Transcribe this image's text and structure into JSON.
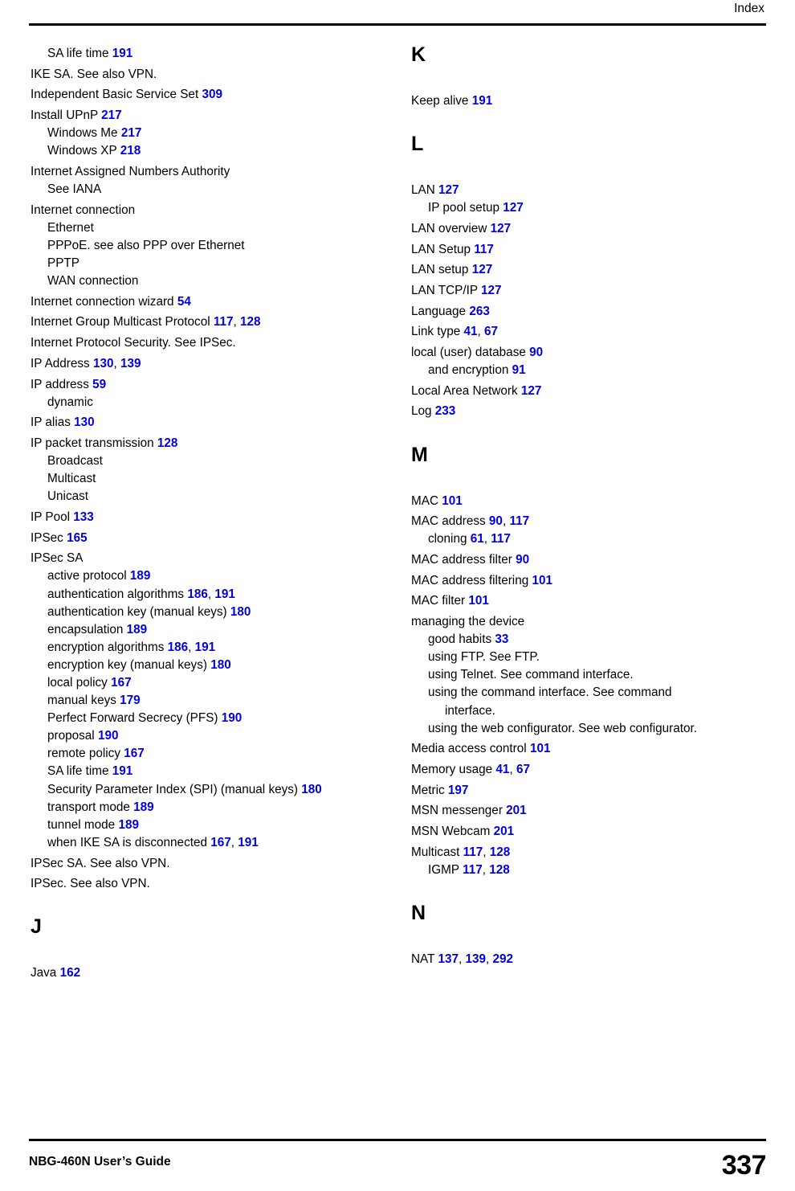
{
  "header": {
    "title": "Index"
  },
  "footer": {
    "guide": "NBG-460N User’s Guide",
    "page_number": "337"
  },
  "colors": {
    "page_ref": "#0000e0",
    "text": "#000000"
  },
  "left_column": {
    "entries": [
      {
        "level": 1,
        "text": "SA life time ",
        "refs": [
          "191"
        ]
      },
      {
        "level": 0,
        "text": "IKE SA. See also VPN.",
        "refs": []
      },
      {
        "level": 0,
        "text": "Independent Basic Service Set ",
        "refs": [
          "309"
        ]
      },
      {
        "level": 0,
        "text": "Install UPnP ",
        "refs": [
          "217"
        ]
      },
      {
        "level": 1,
        "text": "Windows Me ",
        "refs": [
          "217"
        ]
      },
      {
        "level": 1,
        "text": "Windows XP ",
        "refs": [
          "218"
        ]
      },
      {
        "level": 0,
        "text": "Internet Assigned Numbers Authority",
        "refs": []
      },
      {
        "level": 1,
        "text": "See IANA",
        "refs": []
      },
      {
        "level": 0,
        "text": "Internet connection",
        "refs": []
      },
      {
        "level": 1,
        "text": "Ethernet",
        "refs": []
      },
      {
        "level": 1,
        "text": "PPPoE. see also PPP over Ethernet",
        "refs": []
      },
      {
        "level": 1,
        "text": "PPTP",
        "refs": []
      },
      {
        "level": 1,
        "text": "WAN connection",
        "refs": []
      },
      {
        "level": 0,
        "text": "Internet connection wizard ",
        "refs": [
          "54"
        ]
      },
      {
        "level": 0,
        "text": "Internet Group Multicast Protocol ",
        "refs": [
          "117",
          "128"
        ]
      },
      {
        "level": 0,
        "text": "Internet Protocol Security. See IPSec.",
        "refs": []
      },
      {
        "level": 0,
        "text": "IP Address ",
        "refs": [
          "130",
          "139"
        ]
      },
      {
        "level": 0,
        "text": "IP address ",
        "refs": [
          "59"
        ]
      },
      {
        "level": 1,
        "text": "dynamic",
        "refs": []
      },
      {
        "level": 0,
        "text": "IP alias ",
        "refs": [
          "130"
        ]
      },
      {
        "level": 0,
        "text": "IP packet transmission ",
        "refs": [
          "128"
        ]
      },
      {
        "level": 1,
        "text": "Broadcast",
        "refs": []
      },
      {
        "level": 1,
        "text": "Multicast",
        "refs": []
      },
      {
        "level": 1,
        "text": "Unicast",
        "refs": []
      },
      {
        "level": 0,
        "text": "IP Pool ",
        "refs": [
          "133"
        ]
      },
      {
        "level": 0,
        "text": "IPSec ",
        "refs": [
          "165"
        ]
      },
      {
        "level": 0,
        "text": "IPSec SA",
        "refs": []
      },
      {
        "level": 1,
        "text": "active protocol ",
        "refs": [
          "189"
        ]
      },
      {
        "level": 1,
        "text": "authentication algorithms ",
        "refs": [
          "186",
          "191"
        ]
      },
      {
        "level": 1,
        "text": "authentication key (manual keys) ",
        "refs": [
          "180"
        ]
      },
      {
        "level": 1,
        "text": "encapsulation ",
        "refs": [
          "189"
        ]
      },
      {
        "level": 1,
        "text": "encryption algorithms ",
        "refs": [
          "186",
          "191"
        ]
      },
      {
        "level": 1,
        "text": "encryption key (manual keys) ",
        "refs": [
          "180"
        ]
      },
      {
        "level": 1,
        "text": "local policy ",
        "refs": [
          "167"
        ]
      },
      {
        "level": 1,
        "text": "manual keys ",
        "refs": [
          "179"
        ]
      },
      {
        "level": 1,
        "text": "Perfect Forward Secrecy (PFS) ",
        "refs": [
          "190"
        ]
      },
      {
        "level": 1,
        "text": "proposal ",
        "refs": [
          "190"
        ]
      },
      {
        "level": 1,
        "text": "remote policy ",
        "refs": [
          "167"
        ]
      },
      {
        "level": 1,
        "text": "SA life time ",
        "refs": [
          "191"
        ]
      },
      {
        "level": 1,
        "text": "Security Parameter Index (SPI) (manual keys) ",
        "refs": [
          "180"
        ]
      },
      {
        "level": 1,
        "text": "transport mode ",
        "refs": [
          "189"
        ]
      },
      {
        "level": 1,
        "text": "tunnel mode ",
        "refs": [
          "189"
        ]
      },
      {
        "level": 1,
        "text": "when IKE SA is disconnected ",
        "refs": [
          "167",
          "191"
        ]
      },
      {
        "level": 0,
        "text": "IPSec SA. See also VPN.",
        "refs": []
      },
      {
        "level": 0,
        "text": "IPSec. See also VPN.",
        "refs": []
      }
    ],
    "section_letter": "J",
    "after_letter_entries": [
      {
        "level": 0,
        "text": "Java ",
        "refs": [
          "162"
        ]
      }
    ]
  },
  "right_column": {
    "sections": [
      {
        "letter": "K",
        "entries": [
          {
            "level": 0,
            "text": "Keep alive ",
            "refs": [
              "191"
            ]
          }
        ]
      },
      {
        "letter": "L",
        "entries": [
          {
            "level": 0,
            "text": "LAN ",
            "refs": [
              "127"
            ]
          },
          {
            "level": 1,
            "text": "IP pool setup ",
            "refs": [
              "127"
            ]
          },
          {
            "level": 0,
            "text": "LAN overview ",
            "refs": [
              "127"
            ]
          },
          {
            "level": 0,
            "text": "LAN Setup ",
            "refs": [
              "117"
            ]
          },
          {
            "level": 0,
            "text": "LAN setup ",
            "refs": [
              "127"
            ]
          },
          {
            "level": 0,
            "text": "LAN TCP/IP ",
            "refs": [
              "127"
            ]
          },
          {
            "level": 0,
            "text": "Language ",
            "refs": [
              "263"
            ]
          },
          {
            "level": 0,
            "text": "Link type ",
            "refs": [
              "41",
              "67"
            ]
          },
          {
            "level": 0,
            "text": "local (user) database ",
            "refs": [
              "90"
            ]
          },
          {
            "level": 1,
            "text": "and encryption ",
            "refs": [
              "91"
            ]
          },
          {
            "level": 0,
            "text": "Local Area Network ",
            "refs": [
              "127"
            ]
          },
          {
            "level": 0,
            "text": "Log ",
            "refs": [
              "233"
            ]
          }
        ]
      },
      {
        "letter": "M",
        "entries": [
          {
            "level": 0,
            "text": "MAC ",
            "refs": [
              "101"
            ]
          },
          {
            "level": 0,
            "text": "MAC address ",
            "refs": [
              "90",
              "117"
            ]
          },
          {
            "level": 1,
            "text": "cloning ",
            "refs": [
              "61",
              "117"
            ]
          },
          {
            "level": 0,
            "text": "MAC address filter ",
            "refs": [
              "90"
            ]
          },
          {
            "level": 0,
            "text": "MAC address filtering ",
            "refs": [
              "101"
            ]
          },
          {
            "level": 0,
            "text": "MAC filter ",
            "refs": [
              "101"
            ]
          },
          {
            "level": 0,
            "text": "managing the device",
            "refs": []
          },
          {
            "level": 1,
            "text": "good habits ",
            "refs": [
              "33"
            ]
          },
          {
            "level": 1,
            "text": "using FTP. See FTP.",
            "refs": []
          },
          {
            "level": 1,
            "text": "using Telnet. See command interface.",
            "refs": []
          },
          {
            "level": 1,
            "text": "using the command interface. See command",
            "refs": []
          },
          {
            "level": 2,
            "text": "interface.",
            "refs": []
          },
          {
            "level": 1,
            "text": "using the web configurator. See web configurator.",
            "refs": []
          },
          {
            "level": 0,
            "text": "Media access control ",
            "refs": [
              "101"
            ]
          },
          {
            "level": 0,
            "text": "Memory usage ",
            "refs": [
              "41",
              "67"
            ]
          },
          {
            "level": 0,
            "text": "Metric ",
            "refs": [
              "197"
            ]
          },
          {
            "level": 0,
            "text": "MSN messenger ",
            "refs": [
              "201"
            ]
          },
          {
            "level": 0,
            "text": "MSN Webcam ",
            "refs": [
              "201"
            ]
          },
          {
            "level": 0,
            "text": "Multicast ",
            "refs": [
              "117",
              "128"
            ]
          },
          {
            "level": 1,
            "text": "IGMP ",
            "refs": [
              "117",
              "128"
            ]
          }
        ]
      },
      {
        "letter": "N",
        "entries": [
          {
            "level": 0,
            "text": "NAT ",
            "refs": [
              "137",
              "139",
              "292"
            ]
          }
        ]
      }
    ]
  }
}
